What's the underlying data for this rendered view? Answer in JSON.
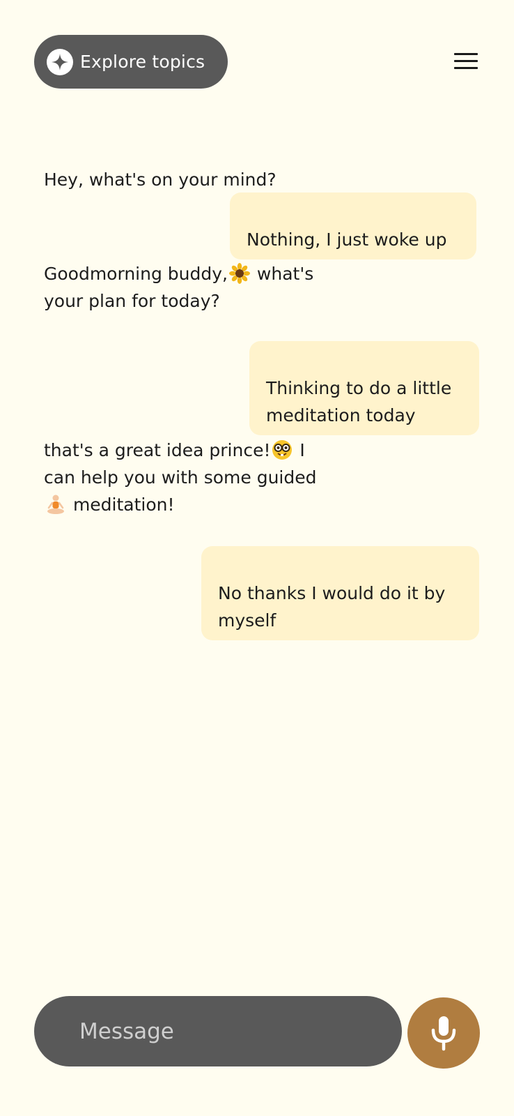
{
  "header": {
    "explore_label": "Explore topics"
  },
  "messages": [
    {
      "role": "bot",
      "text": "Hey, what's on your mind?"
    },
    {
      "role": "user",
      "text": "Nothing, I just woke up"
    },
    {
      "role": "bot",
      "part1": "Goodmorning buddy,",
      "emoji": "sunflower",
      "part2": " what's\nyour plan for today?"
    },
    {
      "role": "user",
      "text": "Thinking to do a little\nmeditation today"
    },
    {
      "role": "bot",
      "part1": "that's a great idea prince!",
      "emoji": "nerd-face",
      "part2": " I\ncan help you with some guided\n",
      "emoji2": "person-in-lotus-position",
      "part3": " meditation!"
    },
    {
      "role": "user",
      "text": "No thanks I would do it by\nmyself"
    }
  ],
  "composer": {
    "placeholder": "Message"
  },
  "icons": {
    "explore": "sparkle-icon",
    "menu": "hamburger-menu-icon",
    "mic": "microphone-icon"
  },
  "colors": {
    "background": "#FFFDF0",
    "dark_pill": "#595959",
    "user_bubble": "#FFF3CC",
    "mic_accent": "#B07D40"
  }
}
